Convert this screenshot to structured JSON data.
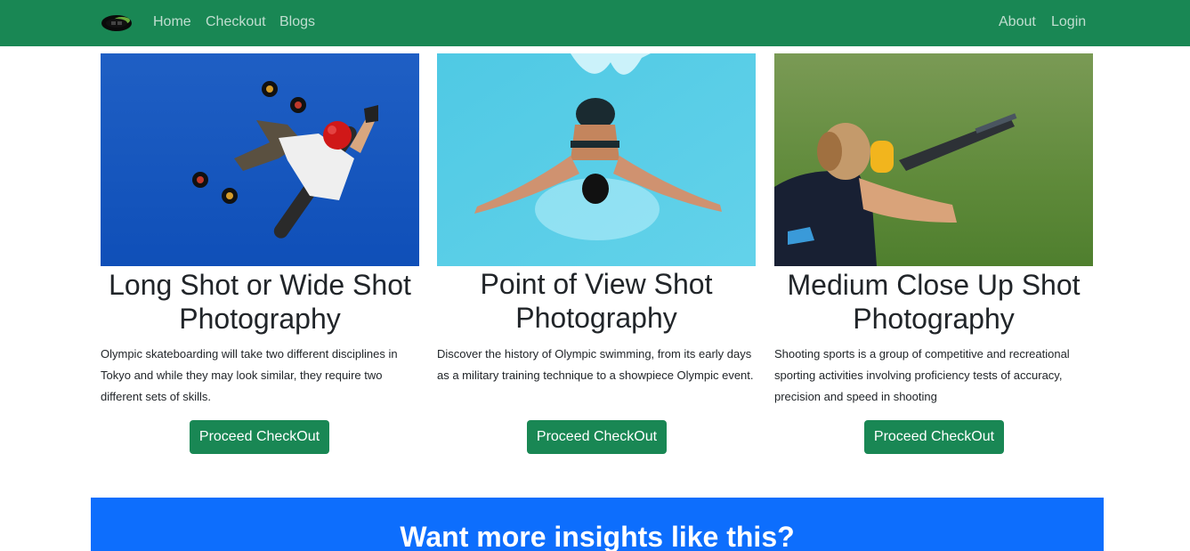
{
  "navbar": {
    "logo_icon": "site-logo",
    "links_left": [
      "Home",
      "Checkout",
      "Blogs"
    ],
    "links_right": [
      "About",
      "Login"
    ],
    "background": "#198754"
  },
  "cards": [
    {
      "image": "skateboarder-in-air-photo",
      "title": "Long Shot or Wide Shot Photography",
      "text": "Olympic skateboarding will take two different disciplines in Tokyo and while they may look similar, they require two different sets of skills.",
      "button": "Proceed CheckOut"
    },
    {
      "image": "swimmer-butterfly-stroke-photo",
      "title": "Point of View Shot Photography",
      "text": "Discover the history of Olympic swimming, from its early days as a military training technique to a showpiece Olympic event.",
      "button": "Proceed CheckOut"
    },
    {
      "image": "trap-shooter-aiming-photo",
      "title": "Medium Close Up Shot Photography",
      "text": "Shooting sports is a group of competitive and recreational sporting activities involving proficiency tests of accuracy, precision and speed in shooting",
      "button": "Proceed CheckOut"
    }
  ],
  "banner": {
    "title": "Want more insights like this?",
    "background": "#0d6efd"
  }
}
